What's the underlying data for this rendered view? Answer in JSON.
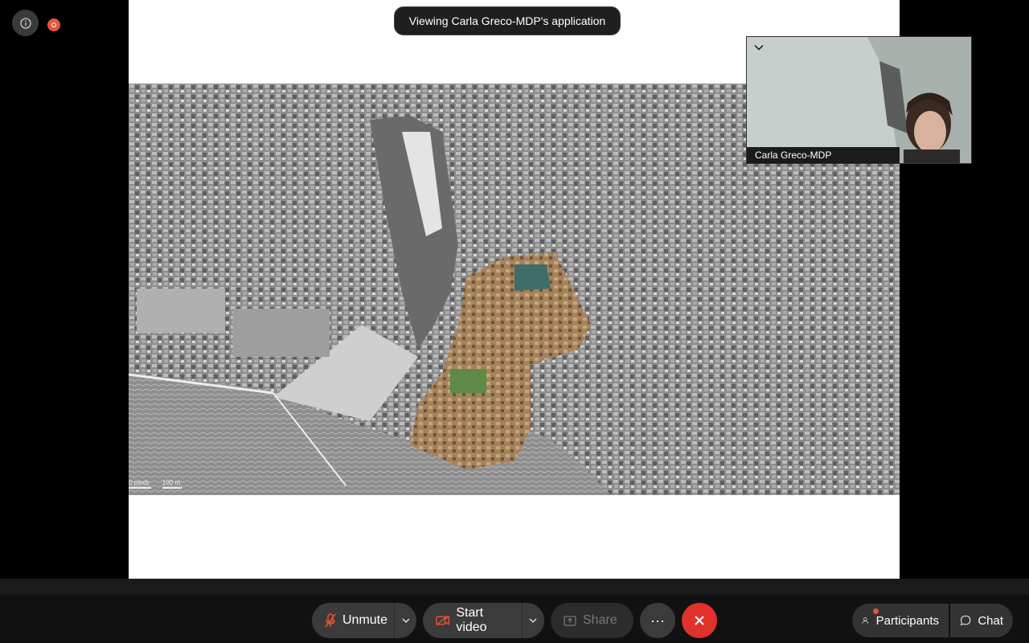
{
  "banner": {
    "viewing_text": "Viewing Carla Greco-MDP's application"
  },
  "video_tile": {
    "participant_name": "Carla Greco-MDP"
  },
  "map": {
    "scale_left": "0 pieds",
    "scale_right": "100 m"
  },
  "toolbar": {
    "unmute_label": "Unmute",
    "start_video_label": "Start video",
    "share_label": "Share",
    "more_label": "···",
    "participants_label": "Participants",
    "chat_label": "Chat"
  },
  "colors": {
    "end_call": "#e0312a",
    "recording": "#e5553b",
    "mic_muted_icon": "#e5553b"
  },
  "icons": [
    "info-icon",
    "recording-icon",
    "chevron-down-icon",
    "mic-muted-icon",
    "video-off-icon",
    "share-icon",
    "more-icon",
    "close-icon",
    "participants-icon",
    "chat-icon"
  ]
}
